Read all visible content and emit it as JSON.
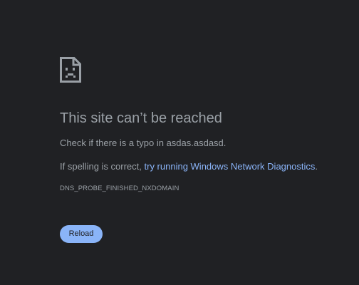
{
  "error": {
    "title": "This site can’t be reached",
    "typo_text": "Check if there is a typo in asdas.asdasd.",
    "spelling_prefix": "If spelling is correct, ",
    "diagnostics_link": "try running Windows Network Diagnostics",
    "spelling_suffix": ".",
    "code": "DNS_PROBE_FINISHED_NXDOMAIN",
    "icon": "sad-document-icon"
  },
  "actions": {
    "reload_label": "Reload"
  },
  "colors": {
    "background": "#202124",
    "text": "#9aa0a6",
    "link": "#8ab4f8",
    "button": "#8ab4f8"
  }
}
